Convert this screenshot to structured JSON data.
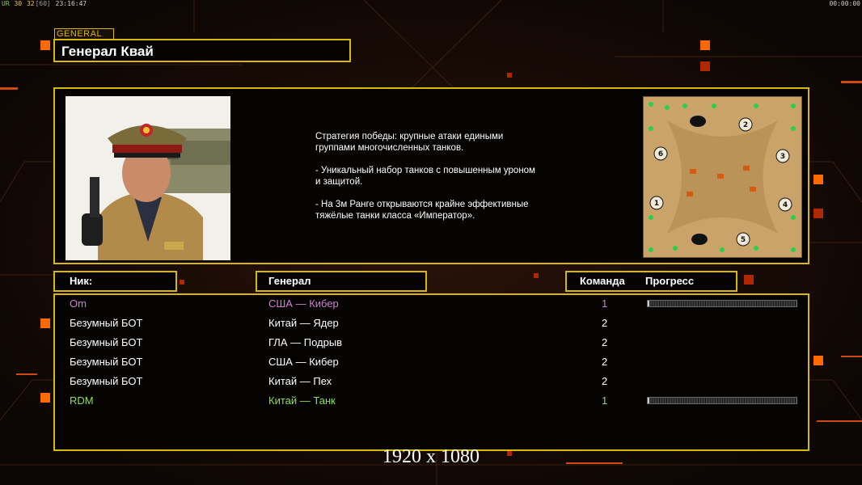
{
  "hud": {
    "left_tag": "UR",
    "left_values": [
      "30",
      "32",
      "[60]",
      "23:16:47"
    ],
    "right_time": "00:00:00"
  },
  "category_tag": "GENERAL",
  "title": "Генерал Квай",
  "portrait_icon": "general-portrait-image",
  "description": "Стратегия победы: крупные атаки едиными\n группами многочисленных танков.\n\n- Уникальный набор танков с повышенным уроном\n и защитой.\n\n- На 3м Ранге открываются крайне эффективные\n тяжёлые танки класса «Император».",
  "minimap": {
    "start_positions": [
      "1",
      "2",
      "3",
      "4",
      "5",
      "6"
    ]
  },
  "table": {
    "headers": {
      "nick": "Ник:",
      "general": "Генерал",
      "team": "Команда",
      "progress": "Прогресс"
    },
    "rows": [
      {
        "nick": "Om",
        "general": "США — Кибер",
        "team": "1",
        "color": "#d27fd6",
        "progress": 0.01,
        "show_progress": true
      },
      {
        "nick": "Безумный БОТ",
        "general": "Китай — Ядер",
        "team": "2",
        "color": "#ffffff",
        "show_progress": false
      },
      {
        "nick": "Безумный БОТ",
        "general": "ГЛА — Подрыв",
        "team": "2",
        "color": "#ffffff",
        "show_progress": false
      },
      {
        "nick": "Безумный БОТ",
        "general": "США — Кибер",
        "team": "2",
        "color": "#ffffff",
        "show_progress": false
      },
      {
        "nick": "Безумный БОТ",
        "general": "Китай — Пех",
        "team": "2",
        "color": "#ffffff",
        "show_progress": false
      },
      {
        "nick": "RDM",
        "general": "Китай — Танк",
        "team": "1",
        "color": "#8ee04a",
        "progress": 0.01,
        "show_progress": true
      }
    ]
  },
  "resolution": "1920 x 1080",
  "colors": {
    "frame": "#d8b800",
    "accent": "#ff6a00",
    "background": "#120a06"
  }
}
